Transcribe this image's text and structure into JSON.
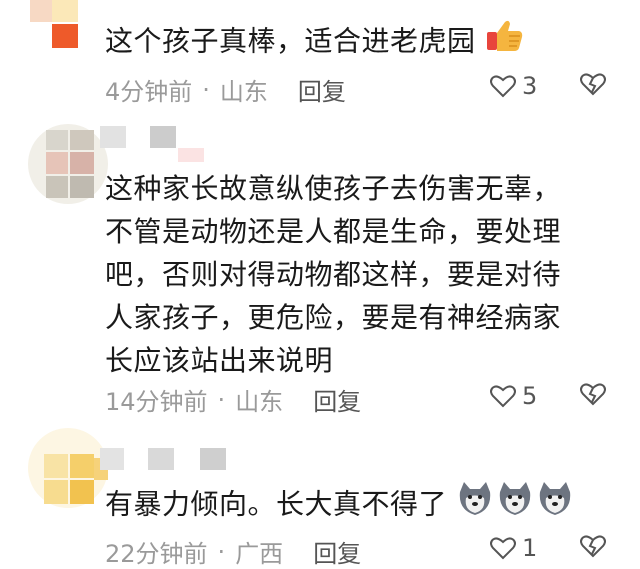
{
  "comments": [
    {
      "text_lines": [
        "这个孩子真棒，适合进老虎园"
      ],
      "emoji": "thumbs-up-icon",
      "time": "4分钟前",
      "location": "山东",
      "reply": "回复",
      "likes": "3"
    },
    {
      "text_lines": [
        "这种家长故意纵使孩子去伤害无辜，",
        "不管是动物还是人都是生命，要处理",
        "吧，否则对得动物都这样，要是对待",
        "人家孩子，更危险，要是有神经病家",
        "长应该站出来说明"
      ],
      "time": "14分钟前",
      "location": "山东",
      "reply": "回复",
      "likes": "5"
    },
    {
      "text_lines": [
        "有暴力倾向。长大真不得了"
      ],
      "emoji": "husky-face-icon",
      "time": "22分钟前",
      "location": "广西",
      "reply": "回复",
      "likes": "1"
    }
  ],
  "separator": "·",
  "colors": {
    "text": "#1a1a1a",
    "meta": "#9a9a9a",
    "icon": "#555555"
  }
}
